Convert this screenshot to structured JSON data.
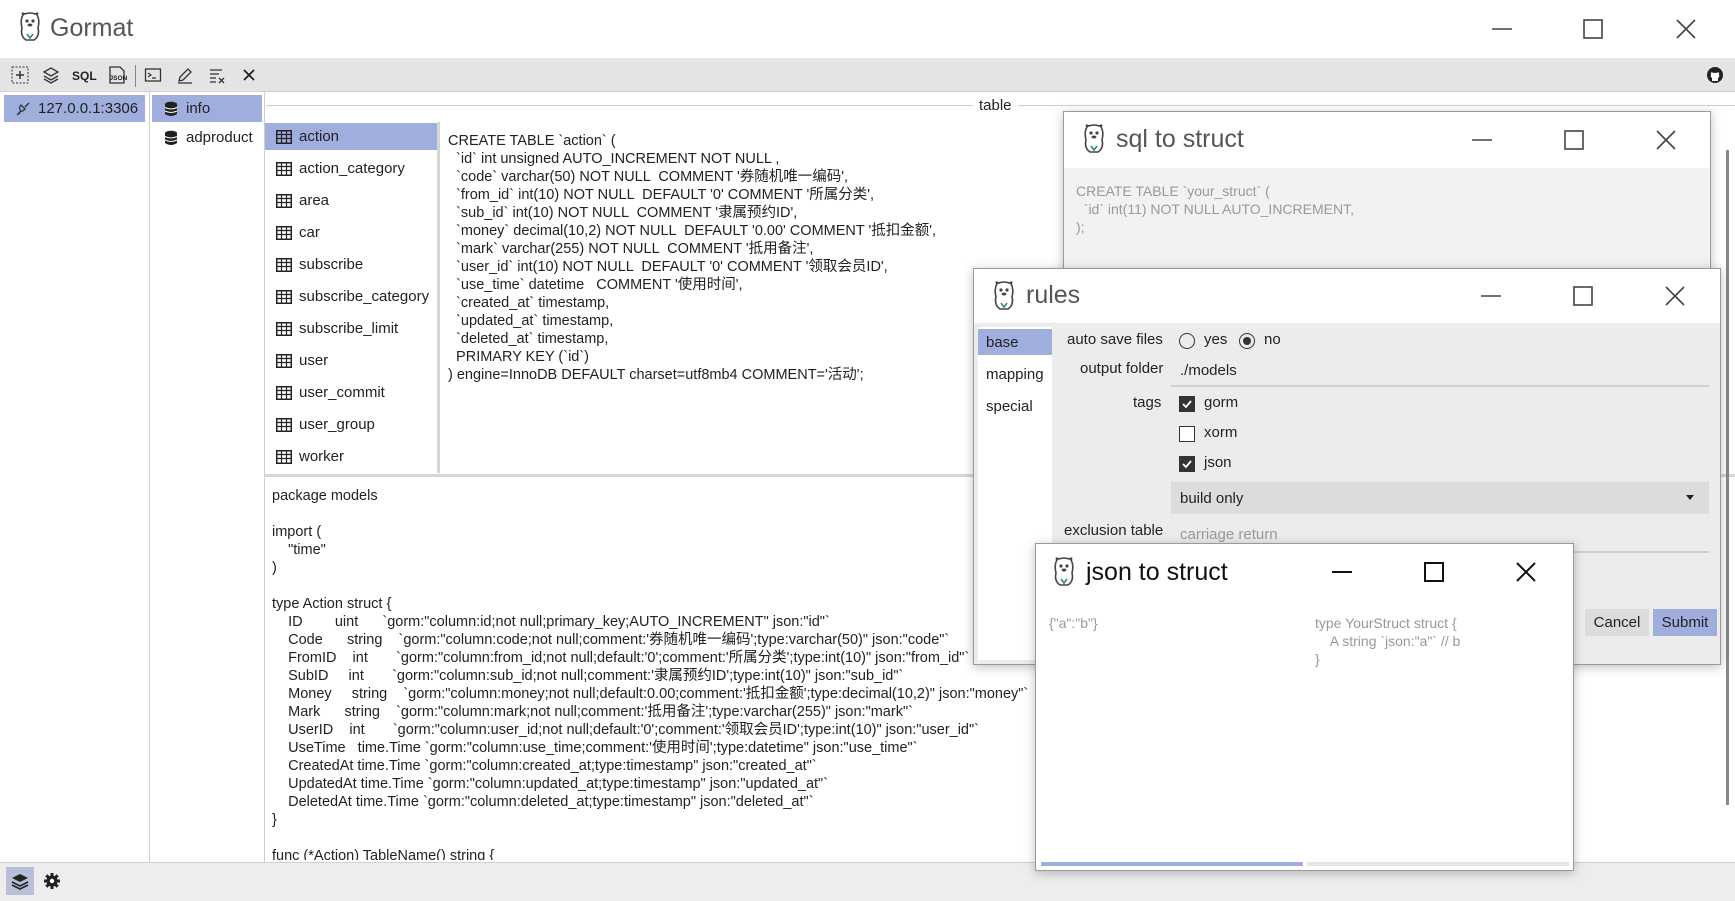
{
  "app": {
    "title": "Gormat"
  },
  "connections": [
    {
      "label": "127.0.0.1:3306"
    }
  ],
  "databases": [
    {
      "label": "info"
    },
    {
      "label": "adproduct"
    }
  ],
  "tables": [
    "action",
    "action_category",
    "area",
    "car",
    "subscribe",
    "subscribe_category",
    "subscribe_limit",
    "user",
    "user_commit",
    "user_group",
    "worker"
  ],
  "table_section_label": "table",
  "sql_text": "CREATE TABLE `action` (\n  `id` int unsigned AUTO_INCREMENT NOT NULL ,\n  `code` varchar(50) NOT NULL  COMMENT '券随机唯一编码',\n  `from_id` int(10) NOT NULL  DEFAULT '0' COMMENT '所属分类',\n  `sub_id` int(10) NOT NULL  COMMENT '隶属预约ID',\n  `money` decimal(10,2) NOT NULL  DEFAULT '0.00' COMMENT '抵扣金额',\n  `mark` varchar(255) NOT NULL  COMMENT '抵用备注',\n  `user_id` int(10) NOT NULL  DEFAULT '0' COMMENT '领取会员ID',\n  `use_time` datetime   COMMENT '使用时间',\n  `created_at` timestamp,\n  `updated_at` timestamp,\n  `deleted_at` timestamp,\n  PRIMARY KEY (`id`)\n) engine=InnoDB DEFAULT charset=utf8mb4 COMMENT='活动';",
  "go_text": "package models\n\nimport (\n    \"time\"\n)\n\ntype Action struct {\n    ID        uint      `gorm:\"column:id;not null;primary_key;AUTO_INCREMENT\" json:\"id\"`\n    Code      string    `gorm:\"column:code;not null;comment:'券随机唯一编码';type:varchar(50)\" json:\"code\"`\n    FromID    int       `gorm:\"column:from_id;not null;default:'0';comment:'所属分类';type:int(10)\" json:\"from_id\"`\n    SubID     int       `gorm:\"column:sub_id;not null;comment:'隶属预约ID';type:int(10)\" json:\"sub_id\"`\n    Money     string    `gorm:\"column:money;not null;default:0.00;comment:'抵扣金额';type:decimal(10,2)\" json:\"money\"`\n    Mark      string    `gorm:\"column:mark;not null;comment:'抵用备注';type:varchar(255)\" json:\"mark\"`\n    UserID    int       `gorm:\"column:user_id;not null;default:'0';comment:'领取会员ID';type:int(10)\" json:\"user_id\"`\n    UseTime   time.Time `gorm:\"column:use_time;comment:'使用时间';type:datetime\" json:\"use_time\"`\n    CreatedAt time.Time `gorm:\"column:created_at;type:timestamp\" json:\"created_at\"`\n    UpdatedAt time.Time `gorm:\"column:updated_at;type:timestamp\" json:\"updated_at\"`\n    DeletedAt time.Time `gorm:\"column:deleted_at;type:timestamp\" json:\"deleted_at\"`\n}\n\nfunc (*Action) TableName() string {",
  "sql_to_struct": {
    "title": "sql to struct",
    "placeholder": "CREATE TABLE `your_struct` (\n  `id` int(11) NOT NULL AUTO_INCREMENT,\n);"
  },
  "rules": {
    "title": "rules",
    "tabs": [
      "base",
      "mapping",
      "special"
    ],
    "auto_save_label": "auto save files",
    "yes_label": "yes",
    "no_label": "no",
    "output_folder_label": "output folder",
    "output_folder_value": "./models",
    "tags_label": "tags",
    "tag_gorm": "gorm",
    "tag_xorm": "xorm",
    "tag_json": "json",
    "build_option": "build only",
    "exclusion_label": "exclusion table",
    "exclusion_placeholder": "carriage return",
    "cancel_label": "Cancel",
    "submit_label": "Submit"
  },
  "json_to_struct": {
    "title": "json to struct",
    "input_placeholder": "{\"a\":\"b\"}",
    "output_placeholder": "type YourStruct struct {\n    A string `json:\"a\"` // b\n}"
  },
  "colors": {
    "selection": "#a0aede",
    "submit": "#a0aede"
  }
}
